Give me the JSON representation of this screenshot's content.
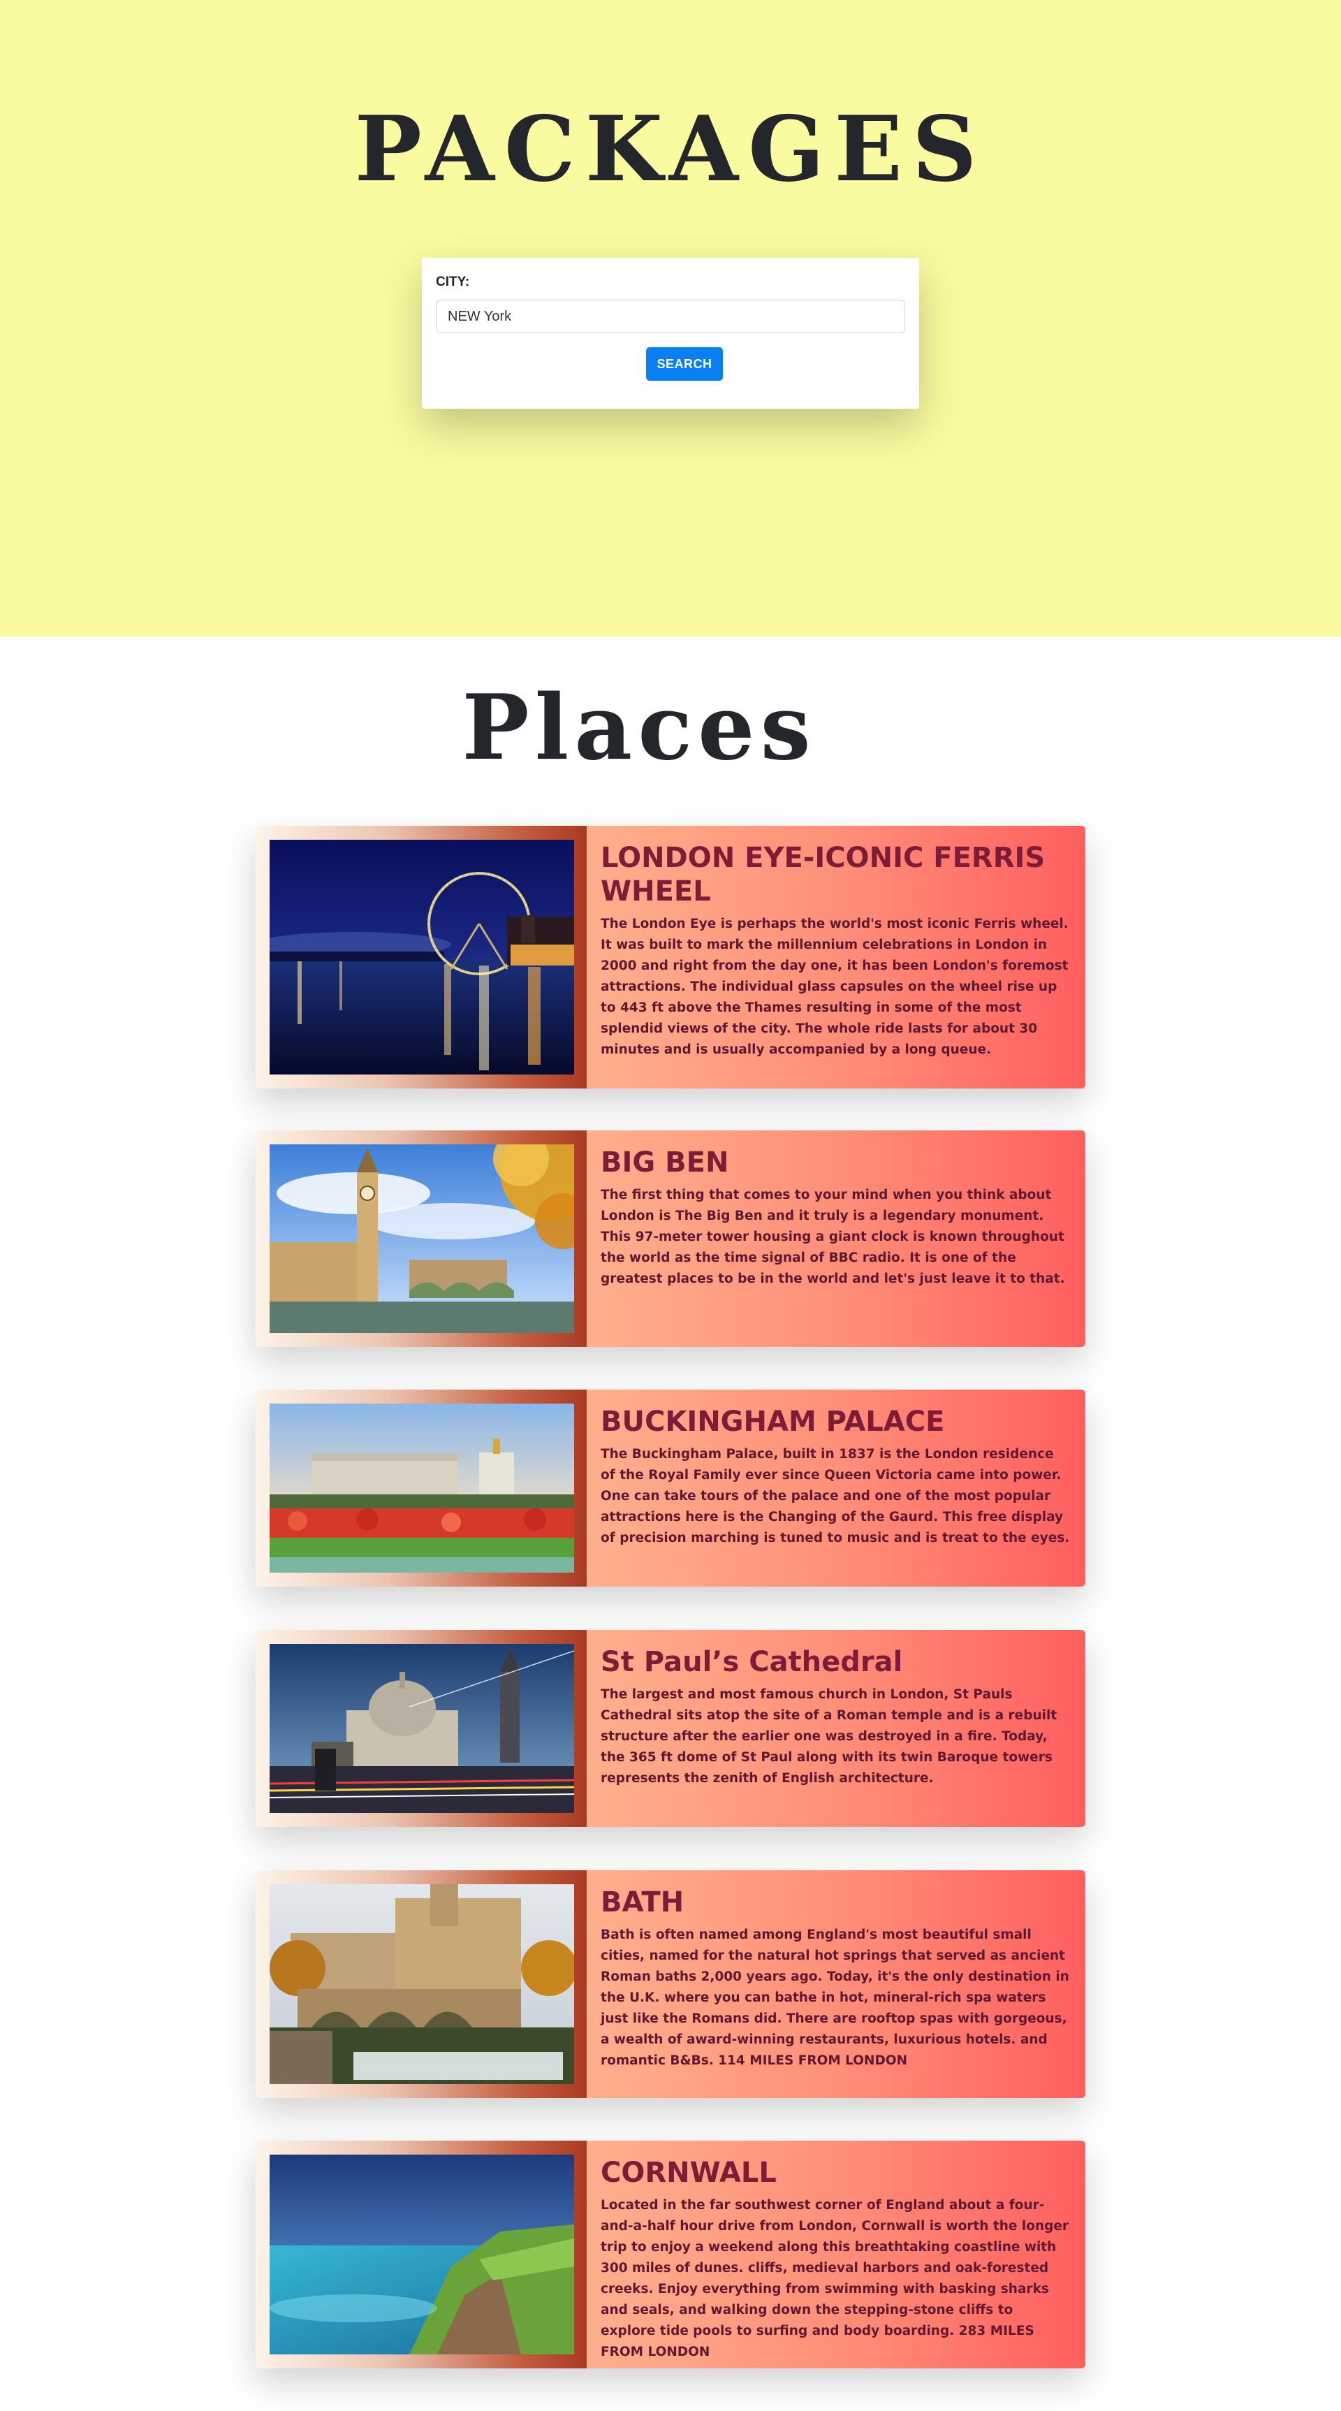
{
  "hero": {
    "title": "PACKAGES",
    "search": {
      "label": "CITY:",
      "value": "NEW York",
      "button": "SEARCH"
    }
  },
  "places": {
    "title": "Places",
    "items": [
      {
        "title": "LONDON EYE-ICONIC FERRIS WHEEL",
        "description": "The London Eye is perhaps the world's most iconic Ferris wheel. It was built to mark the millennium celebrations in London in 2000 and right from the day one, it has been London's foremost attractions. The individual glass capsules on the wheel rise up to 443 ft above the Thames resulting in some of the most splendid views of the city. The whole ride lasts for about 30 minutes and is usually accompanied by a long queue.",
        "image": "london-eye-photo"
      },
      {
        "title": "BIG BEN",
        "description": "The first thing that comes to your mind when you think about London is The Big Ben and it truly is a legendary monument. This 97-meter tower housing a giant clock is known throughout the world as the time signal of BBC radio. It is one of the greatest places to be in the world and let's just leave it to that.",
        "image": "big-ben-photo"
      },
      {
        "title": "BUCKINGHAM PALACE",
        "description": "The Buckingham Palace, built in 1837 is the London residence of the Royal Family ever since Queen Victoria came into power. One can take tours of the palace and one of the most popular attractions here is the Changing of the Gaurd. This free display of precision marching is tuned to music and is treat to the eyes.",
        "image": "buckingham-palace-photo"
      },
      {
        "title": "St Paul’s Cathedral",
        "description": "The largest and most famous church in London, St Pauls Cathedral sits atop the site of a Roman temple and is a rebuilt structure after the earlier one was destroyed in a fire. Today, the 365 ft dome of St Paul along with its twin Baroque towers represents the zenith of English architecture.",
        "image": "st-pauls-cathedral-photo"
      },
      {
        "title": "BATH",
        "description": "Bath is often named among England's most beautiful small cities, named for the natural hot springs that served as ancient Roman baths 2,000 years ago. Today, it's the only destination in the U.K. where you can bathe in hot, mineral-rich spa waters just like the Romans did. There are rooftop spas with gorgeous, a wealth of award-winning restaurants, luxurious hotels. and romantic B&Bs. 114 MILES FROM LONDON",
        "image": "bath-photo"
      },
      {
        "title": "CORNWALL",
        "description": "Located in the far southwest corner of England about a four-and-a-half hour drive from London, Cornwall is worth the longer trip to enjoy a weekend along this breathtaking coastline with 300 miles of dunes. cliffs, medieval harbors and oak-forested creeks. Enjoy everything from swimming with basking sharks and seals, and walking down the stepping-stone cliffs to explore tide pools to surfing and body boarding. 283 MILES FROM LONDON",
        "image": "cornwall-photo"
      }
    ]
  },
  "colors": {
    "hero_background": "#fafaa0",
    "accent_button": "#0a7ff2",
    "card_title": "#7e1c38",
    "card_text": "#5f1830",
    "card_gradient_start": "#ffb08e",
    "card_gradient_end": "#ff5f5f"
  }
}
